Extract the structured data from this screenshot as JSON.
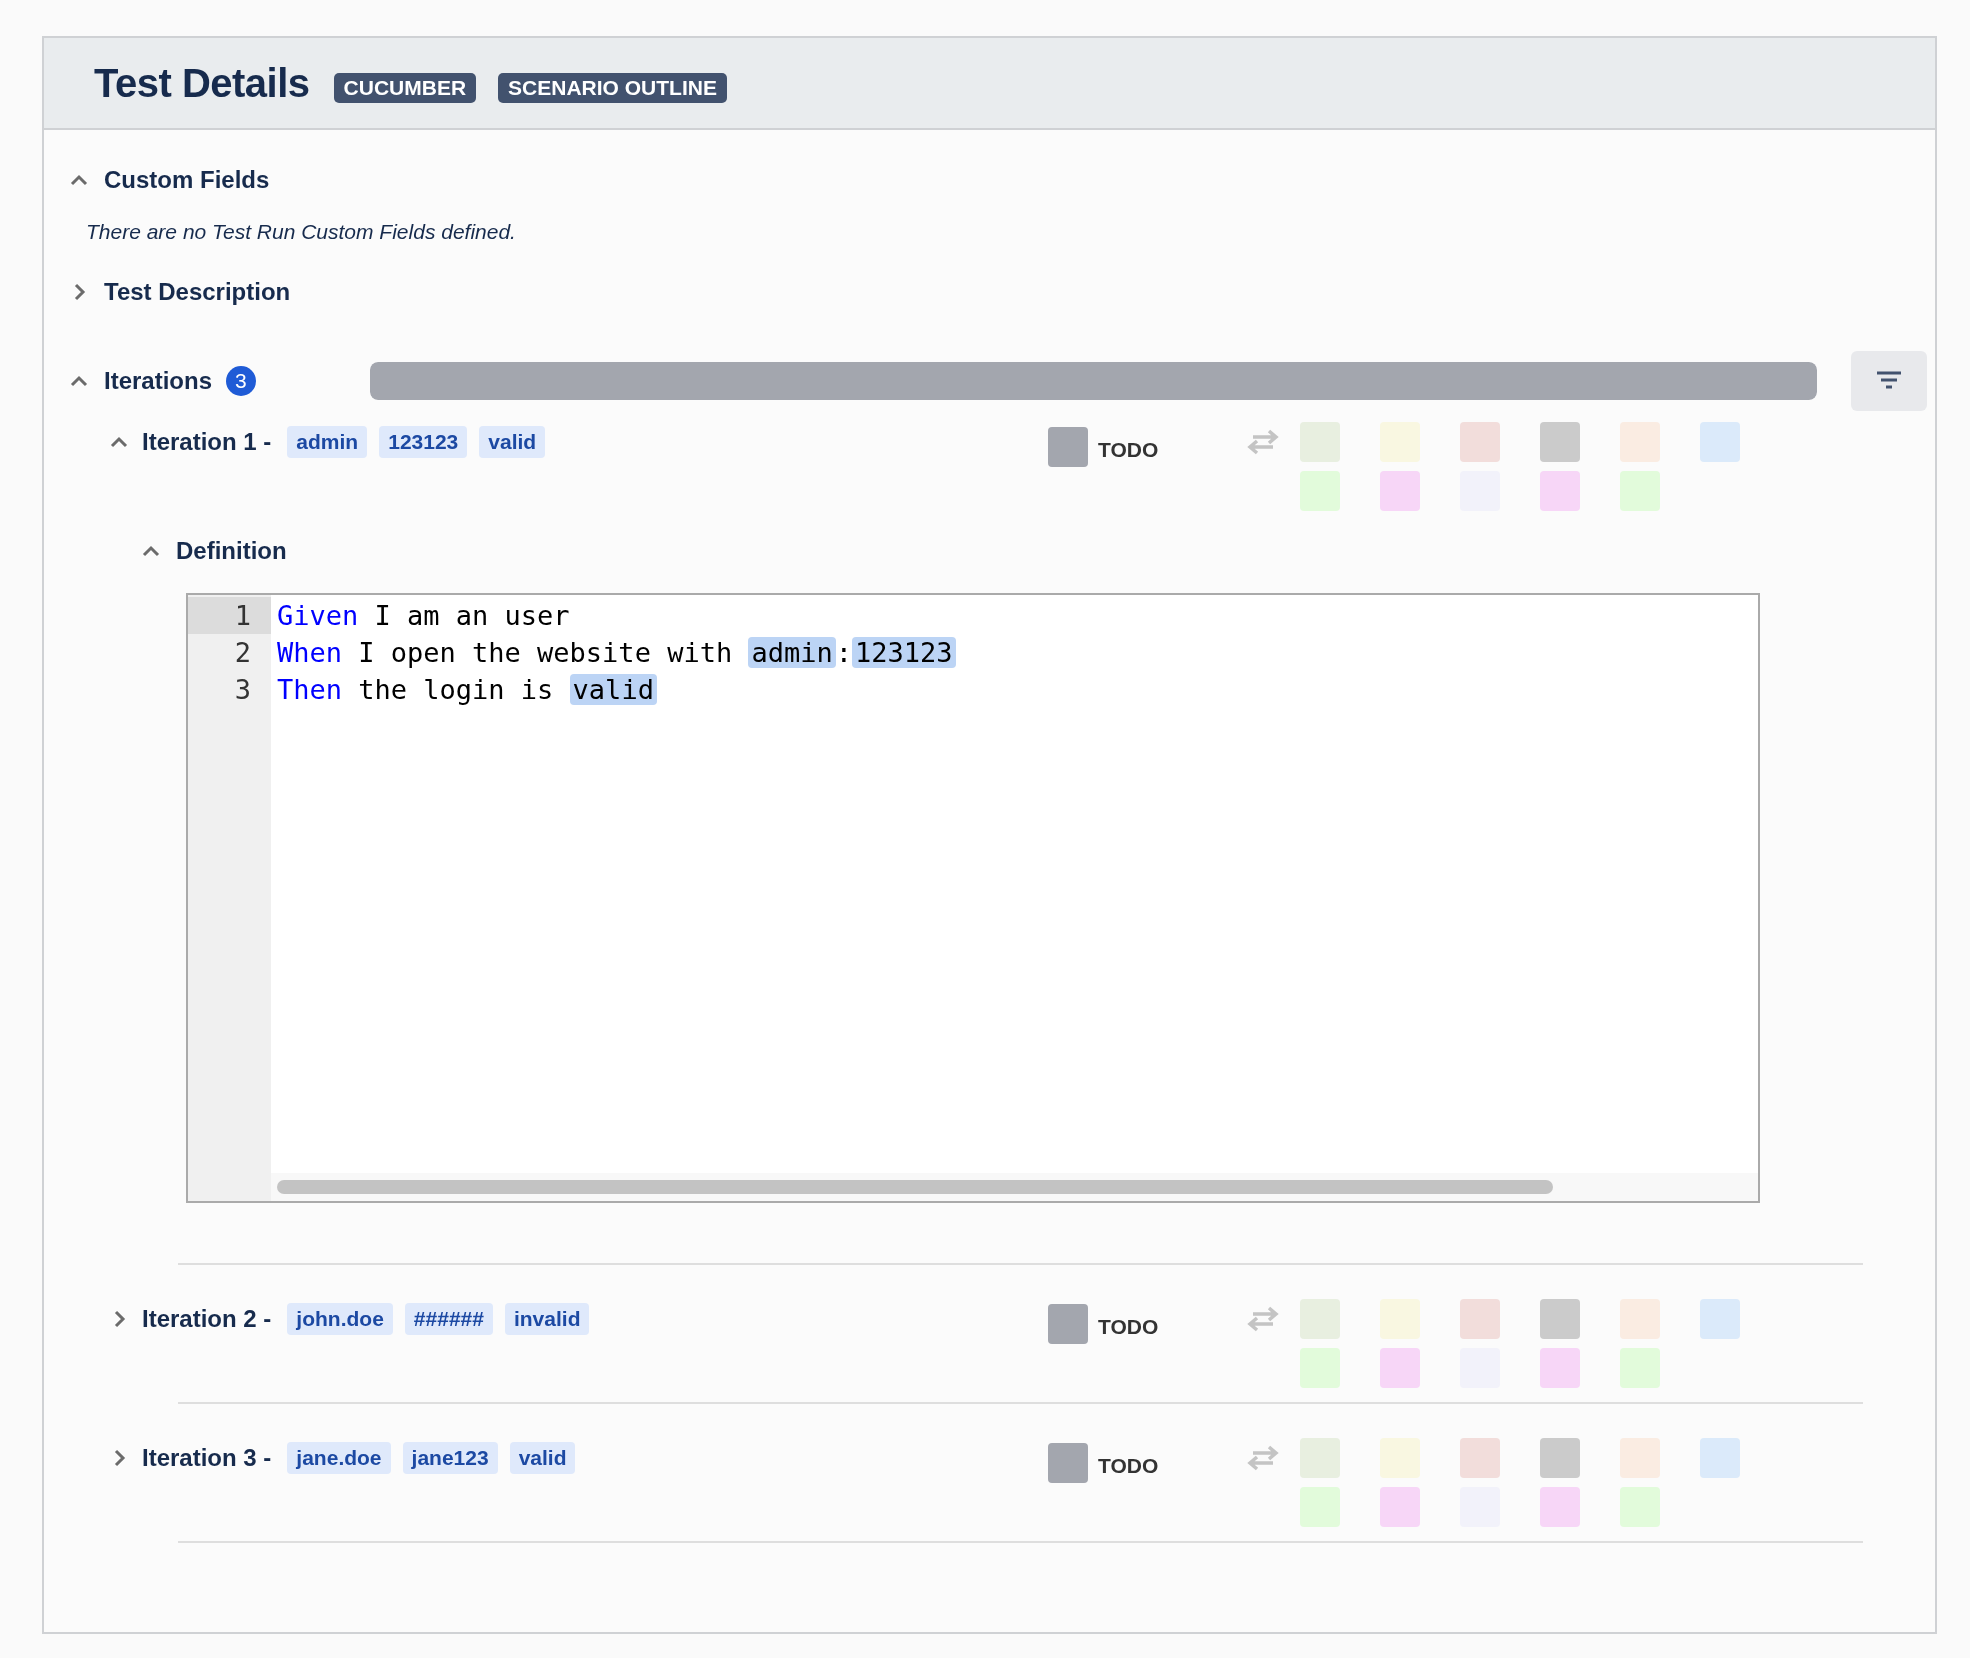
{
  "header": {
    "title": "Test Details",
    "badges": [
      "CUCUMBER",
      "SCENARIO OUTLINE"
    ]
  },
  "custom_fields": {
    "title": "Custom Fields",
    "expanded": true,
    "message": "There are no Test Run Custom Fields defined."
  },
  "test_description": {
    "title": "Test Description",
    "expanded": false
  },
  "iterations": {
    "title": "Iterations",
    "expanded": true,
    "count": "3",
    "progress": {
      "level": 1,
      "color": "#a3a6ae"
    },
    "status_buttons": [
      {
        "color": "#e8efe0"
      },
      {
        "color": "#f9f7e1"
      },
      {
        "color": "#f2dddb"
      },
      {
        "color": "#cbcbcb"
      },
      {
        "color": "#faece2"
      },
      {
        "color": "#dbeafa"
      },
      {
        "color": "#e2fbdb"
      },
      {
        "color": "#f7d6f7"
      },
      {
        "color": "#f2f2fa"
      },
      {
        "color": "#f7d6f7"
      },
      {
        "color": "#e2fbdb"
      }
    ],
    "items": [
      {
        "label": "Iteration 1 -",
        "expanded": true,
        "params": [
          "admin",
          "123123",
          "valid"
        ],
        "status": {
          "label": "TODO",
          "color": "#a3a6ae"
        },
        "definition": {
          "title": "Definition",
          "expanded": true,
          "lines": [
            {
              "number": "1",
              "active": true,
              "tokens": [
                {
                  "kind": "keyword",
                  "text": "Given"
                },
                {
                  "kind": "text",
                  "text": " I am an user"
                }
              ]
            },
            {
              "number": "2",
              "active": false,
              "tokens": [
                {
                  "kind": "keyword",
                  "text": "When"
                },
                {
                  "kind": "text",
                  "text": " I open the website with "
                },
                {
                  "kind": "param",
                  "text": "admin"
                },
                {
                  "kind": "text",
                  "text": ":"
                },
                {
                  "kind": "param",
                  "text": "123123"
                }
              ]
            },
            {
              "number": "3",
              "active": false,
              "tokens": [
                {
                  "kind": "keyword",
                  "text": "Then"
                },
                {
                  "kind": "text",
                  "text": " the login is "
                },
                {
                  "kind": "param",
                  "text": "valid"
                }
              ]
            }
          ]
        }
      },
      {
        "label": "Iteration 2 -",
        "expanded": false,
        "params": [
          "john.doe",
          "######",
          "invalid"
        ],
        "status": {
          "label": "TODO",
          "color": "#a3a6ae"
        }
      },
      {
        "label": "Iteration 3 -",
        "expanded": false,
        "params": [
          "jane.doe",
          "jane123",
          "valid"
        ],
        "status": {
          "label": "TODO",
          "color": "#a3a6ae"
        }
      }
    ]
  }
}
